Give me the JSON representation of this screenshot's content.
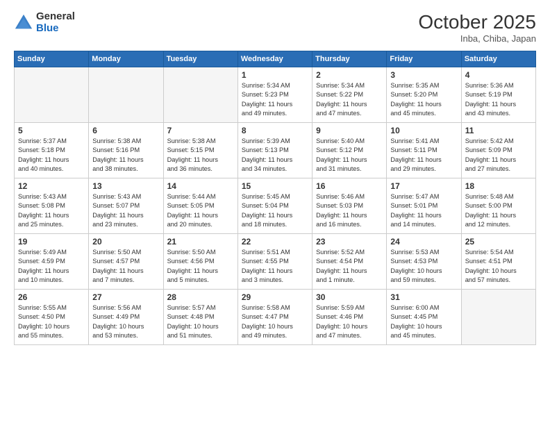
{
  "header": {
    "logo_general": "General",
    "logo_blue": "Blue",
    "month_title": "October 2025",
    "location": "Inba, Chiba, Japan"
  },
  "weekdays": [
    "Sunday",
    "Monday",
    "Tuesday",
    "Wednesday",
    "Thursday",
    "Friday",
    "Saturday"
  ],
  "weeks": [
    [
      {
        "day": "",
        "info": ""
      },
      {
        "day": "",
        "info": ""
      },
      {
        "day": "",
        "info": ""
      },
      {
        "day": "1",
        "info": "Sunrise: 5:34 AM\nSunset: 5:23 PM\nDaylight: 11 hours\nand 49 minutes."
      },
      {
        "day": "2",
        "info": "Sunrise: 5:34 AM\nSunset: 5:22 PM\nDaylight: 11 hours\nand 47 minutes."
      },
      {
        "day": "3",
        "info": "Sunrise: 5:35 AM\nSunset: 5:20 PM\nDaylight: 11 hours\nand 45 minutes."
      },
      {
        "day": "4",
        "info": "Sunrise: 5:36 AM\nSunset: 5:19 PM\nDaylight: 11 hours\nand 43 minutes."
      }
    ],
    [
      {
        "day": "5",
        "info": "Sunrise: 5:37 AM\nSunset: 5:18 PM\nDaylight: 11 hours\nand 40 minutes."
      },
      {
        "day": "6",
        "info": "Sunrise: 5:38 AM\nSunset: 5:16 PM\nDaylight: 11 hours\nand 38 minutes."
      },
      {
        "day": "7",
        "info": "Sunrise: 5:38 AM\nSunset: 5:15 PM\nDaylight: 11 hours\nand 36 minutes."
      },
      {
        "day": "8",
        "info": "Sunrise: 5:39 AM\nSunset: 5:13 PM\nDaylight: 11 hours\nand 34 minutes."
      },
      {
        "day": "9",
        "info": "Sunrise: 5:40 AM\nSunset: 5:12 PM\nDaylight: 11 hours\nand 31 minutes."
      },
      {
        "day": "10",
        "info": "Sunrise: 5:41 AM\nSunset: 5:11 PM\nDaylight: 11 hours\nand 29 minutes."
      },
      {
        "day": "11",
        "info": "Sunrise: 5:42 AM\nSunset: 5:09 PM\nDaylight: 11 hours\nand 27 minutes."
      }
    ],
    [
      {
        "day": "12",
        "info": "Sunrise: 5:43 AM\nSunset: 5:08 PM\nDaylight: 11 hours\nand 25 minutes."
      },
      {
        "day": "13",
        "info": "Sunrise: 5:43 AM\nSunset: 5:07 PM\nDaylight: 11 hours\nand 23 minutes."
      },
      {
        "day": "14",
        "info": "Sunrise: 5:44 AM\nSunset: 5:05 PM\nDaylight: 11 hours\nand 20 minutes."
      },
      {
        "day": "15",
        "info": "Sunrise: 5:45 AM\nSunset: 5:04 PM\nDaylight: 11 hours\nand 18 minutes."
      },
      {
        "day": "16",
        "info": "Sunrise: 5:46 AM\nSunset: 5:03 PM\nDaylight: 11 hours\nand 16 minutes."
      },
      {
        "day": "17",
        "info": "Sunrise: 5:47 AM\nSunset: 5:01 PM\nDaylight: 11 hours\nand 14 minutes."
      },
      {
        "day": "18",
        "info": "Sunrise: 5:48 AM\nSunset: 5:00 PM\nDaylight: 11 hours\nand 12 minutes."
      }
    ],
    [
      {
        "day": "19",
        "info": "Sunrise: 5:49 AM\nSunset: 4:59 PM\nDaylight: 11 hours\nand 10 minutes."
      },
      {
        "day": "20",
        "info": "Sunrise: 5:50 AM\nSunset: 4:57 PM\nDaylight: 11 hours\nand 7 minutes."
      },
      {
        "day": "21",
        "info": "Sunrise: 5:50 AM\nSunset: 4:56 PM\nDaylight: 11 hours\nand 5 minutes."
      },
      {
        "day": "22",
        "info": "Sunrise: 5:51 AM\nSunset: 4:55 PM\nDaylight: 11 hours\nand 3 minutes."
      },
      {
        "day": "23",
        "info": "Sunrise: 5:52 AM\nSunset: 4:54 PM\nDaylight: 11 hours\nand 1 minute."
      },
      {
        "day": "24",
        "info": "Sunrise: 5:53 AM\nSunset: 4:53 PM\nDaylight: 10 hours\nand 59 minutes."
      },
      {
        "day": "25",
        "info": "Sunrise: 5:54 AM\nSunset: 4:51 PM\nDaylight: 10 hours\nand 57 minutes."
      }
    ],
    [
      {
        "day": "26",
        "info": "Sunrise: 5:55 AM\nSunset: 4:50 PM\nDaylight: 10 hours\nand 55 minutes."
      },
      {
        "day": "27",
        "info": "Sunrise: 5:56 AM\nSunset: 4:49 PM\nDaylight: 10 hours\nand 53 minutes."
      },
      {
        "day": "28",
        "info": "Sunrise: 5:57 AM\nSunset: 4:48 PM\nDaylight: 10 hours\nand 51 minutes."
      },
      {
        "day": "29",
        "info": "Sunrise: 5:58 AM\nSunset: 4:47 PM\nDaylight: 10 hours\nand 49 minutes."
      },
      {
        "day": "30",
        "info": "Sunrise: 5:59 AM\nSunset: 4:46 PM\nDaylight: 10 hours\nand 47 minutes."
      },
      {
        "day": "31",
        "info": "Sunrise: 6:00 AM\nSunset: 4:45 PM\nDaylight: 10 hours\nand 45 minutes."
      },
      {
        "day": "",
        "info": ""
      }
    ]
  ]
}
